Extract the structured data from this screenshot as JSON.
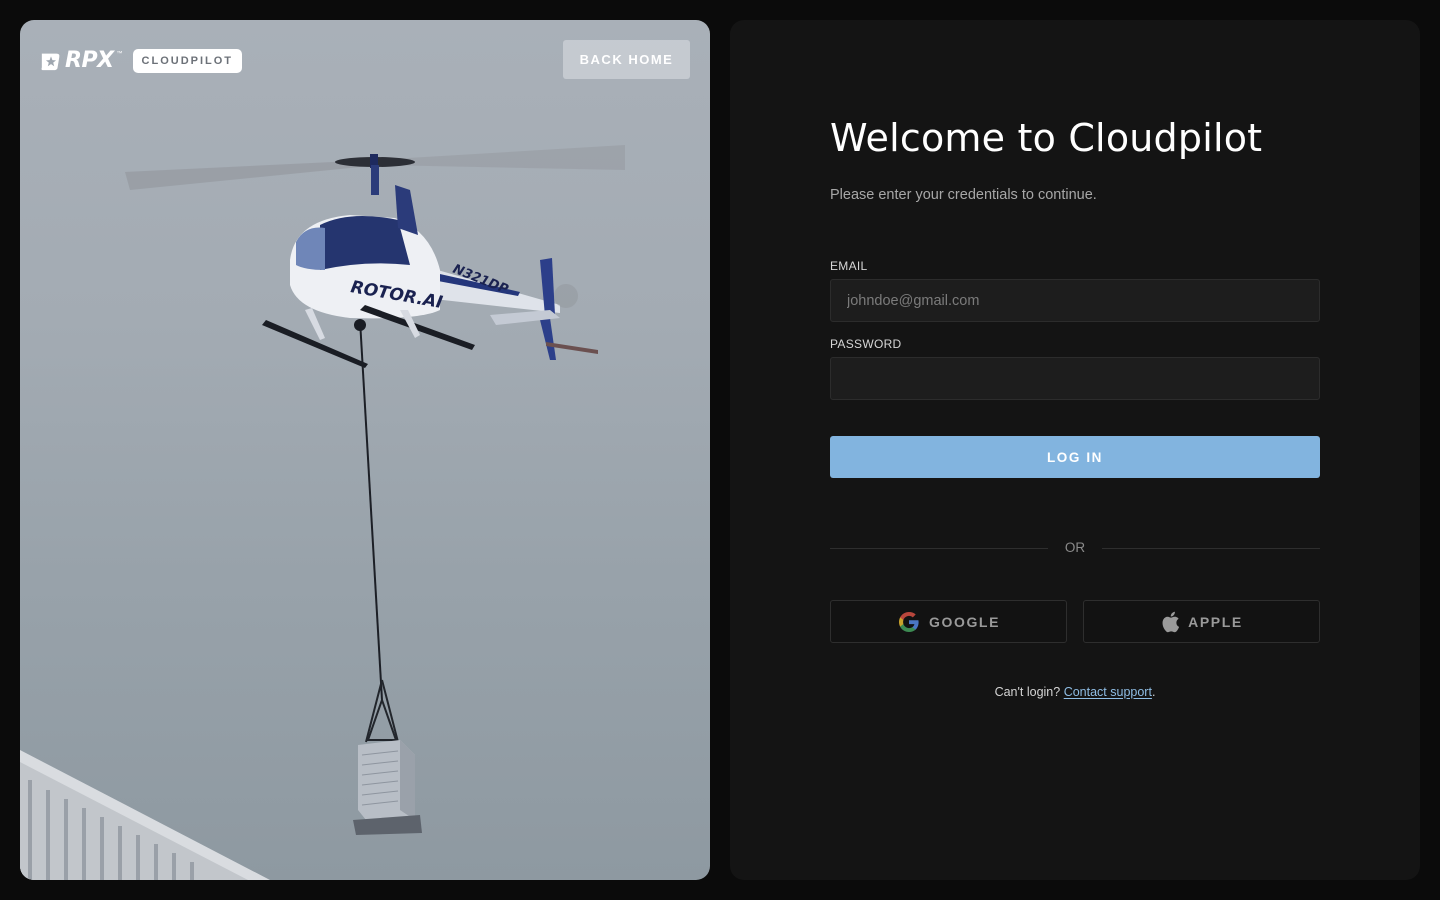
{
  "brand": {
    "logo_text": "RPX",
    "trademark": "™",
    "badge": "CLOUDPILOT"
  },
  "hero": {
    "back_home_label": "BACK HOME",
    "aircraft_livery": "ROTOR.AI",
    "aircraft_tail_number": "N321DP"
  },
  "login": {
    "title": "Welcome to Cloudpilot",
    "subtitle": "Please enter your credentials to continue.",
    "email_label": "EMAIL",
    "email_placeholder": "johndoe@gmail.com",
    "email_value": "",
    "password_label": "PASSWORD",
    "password_value": "",
    "submit_label": "LOG IN",
    "divider_text": "OR",
    "google_label": "GOOGLE",
    "apple_label": "APPLE",
    "help_text": "Can't login?",
    "help_link": "Contact support",
    "help_suffix": "."
  },
  "colors": {
    "page_bg": "#0b0b0b",
    "panel_bg": "#141414",
    "field_bg": "#1d1d1d",
    "primary_button": "#82b4df",
    "link": "#8fbde4"
  },
  "icons": {
    "brand": "rpx-star-logo-icon",
    "google": "google-g-icon",
    "apple": "apple-icon"
  }
}
